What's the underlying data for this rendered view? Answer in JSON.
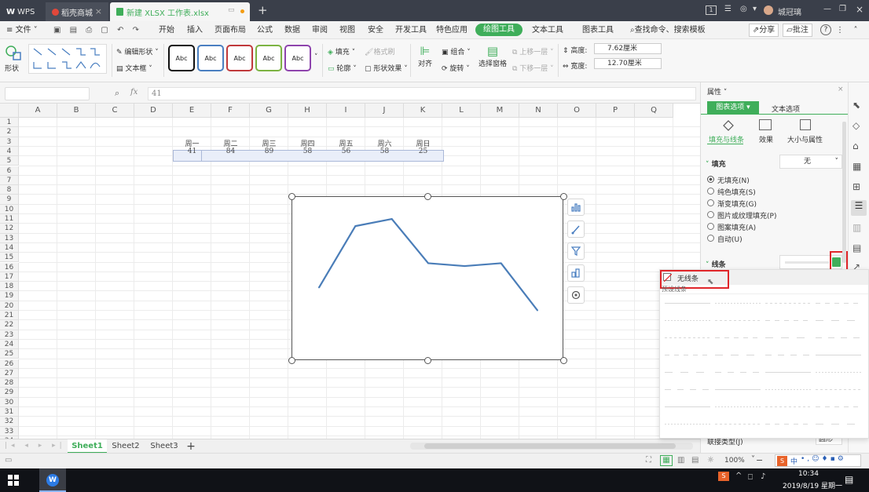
{
  "titlebar": {
    "tabs": [
      {
        "label": "WPS"
      },
      {
        "label": "稻壳商城"
      },
      {
        "label": "新建 XLSX 工作表.xlsx"
      }
    ],
    "new_tab": "+",
    "page_badge": "1",
    "user_name": "城冠璃"
  },
  "menubar": {
    "file": "文件",
    "items": [
      "开始",
      "插入",
      "页面布局",
      "公式",
      "数据",
      "审阅",
      "视图",
      "安全",
      "开发工具",
      "特色应用",
      "绘图工具",
      "文本工具",
      "图表工具"
    ],
    "search": "查找命令、搜索模板",
    "share": "分享",
    "comment": "批注",
    "help": "?"
  },
  "ribbon": {
    "shape": "形状",
    "edit_shape": "编辑形状",
    "text_box": "文本框",
    "style_label": "Abc",
    "fill": "填充",
    "format_brush": "格式刷",
    "outline": "轮廓",
    "shape_effect": "形状效果",
    "align": "对齐",
    "group": "组合",
    "rotate": "旋转",
    "selection_pane": "选择窗格",
    "bring_forward": "上移一层",
    "send_backward": "下移一层",
    "height_label": "高度:",
    "height_value": "7.62厘米",
    "width_label": "宽度:",
    "width_value": "12.70厘米",
    "style_colors": [
      "#111111",
      "#4a7fc1",
      "#c0393b",
      "#7cb342",
      "#8e44ad"
    ]
  },
  "formula_bar": {
    "fx": "fx",
    "value": "41"
  },
  "grid": {
    "columns": [
      "A",
      "B",
      "C",
      "D",
      "E",
      "F",
      "G",
      "H",
      "I",
      "J",
      "K",
      "L",
      "M",
      "N",
      "O",
      "P",
      "Q"
    ],
    "rows": [
      "1",
      "2",
      "3",
      "4",
      "5",
      "6",
      "7",
      "8",
      "9",
      "10",
      "11",
      "12",
      "13",
      "14",
      "15",
      "16",
      "17",
      "18",
      "19",
      "20",
      "21",
      "22",
      "23",
      "24",
      "25",
      "26",
      "27",
      "28",
      "29",
      "30",
      "31",
      "32",
      "33",
      "34"
    ],
    "table_headers": [
      "周一",
      "周二",
      "周三",
      "周四",
      "周五",
      "周六",
      "周日"
    ],
    "table_values": [
      "41",
      "84",
      "89",
      "58",
      "56",
      "58",
      "25"
    ]
  },
  "chart_data": {
    "type": "line",
    "categories": [
      "周一",
      "周二",
      "周三",
      "周四",
      "周五",
      "周六",
      "周日"
    ],
    "values": [
      41,
      84,
      89,
      58,
      56,
      58,
      25
    ],
    "ylim": [
      0,
      100
    ],
    "line_color": "#4a7db8",
    "grid": false,
    "axes_visible": false
  },
  "sheets": {
    "tabs": [
      "Sheet1",
      "Sheet2",
      "Sheet3"
    ],
    "active": "Sheet1",
    "add": "+"
  },
  "status": {
    "zoom": "100%"
  },
  "panel": {
    "title": "属性",
    "tab_chart": "图表选项",
    "tab_text": "文本选项",
    "sub_fill_line": "填充与线条",
    "sub_effect": "效果",
    "sub_size": "大小与属性",
    "fill_section": "填充",
    "fill_value": "无",
    "fill_options": [
      "无填充(N)",
      "纯色填充(S)",
      "渐变填充(G)",
      "图片或纹理填充(P)",
      "图案填充(A)",
      "自动(U)"
    ],
    "line_section": "线条",
    "join_type_label": "联接类型(J)",
    "join_type_value": "圆形"
  },
  "dropdown": {
    "no_line": "无线条",
    "preset_label": "预设线条"
  },
  "taskbar": {
    "time": "10:34",
    "date": "2019/8/19 星期一",
    "ime": "中"
  }
}
